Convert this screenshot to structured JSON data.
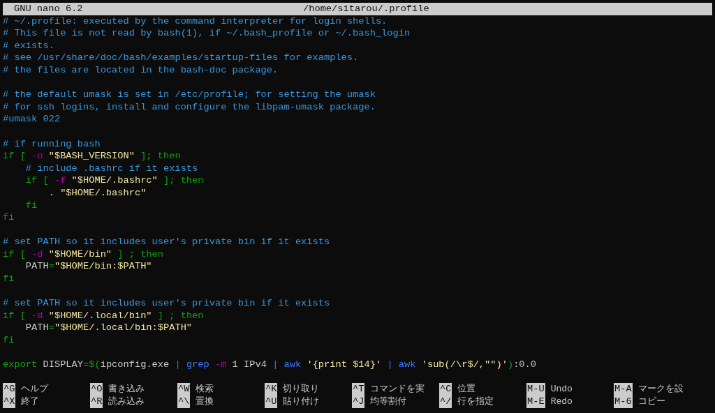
{
  "title_bar": {
    "app": "GNU nano 6.2",
    "file": "/home/sitarou/.profile"
  },
  "lines": [
    {
      "kind": "code",
      "segments": [
        {
          "kind": "comment",
          "text": "# ~/.profile: executed by the command interpreter for login shells."
        }
      ]
    },
    {
      "kind": "code",
      "segments": [
        {
          "kind": "comment",
          "text": "# This file is not read by bash(1), if ~/.bash_profile or ~/.bash_login"
        }
      ]
    },
    {
      "kind": "code",
      "segments": [
        {
          "kind": "comment",
          "text": "# exists."
        }
      ]
    },
    {
      "kind": "code",
      "segments": [
        {
          "kind": "comment",
          "text": "# see /usr/share/doc/bash/examples/startup-files for examples."
        }
      ]
    },
    {
      "kind": "code",
      "segments": [
        {
          "kind": "comment",
          "text": "# the files are located in the bash-doc package."
        }
      ]
    },
    {
      "kind": "blank"
    },
    {
      "kind": "code",
      "segments": [
        {
          "kind": "comment",
          "text": "# the default umask is set in /etc/profile; for setting the umask"
        }
      ]
    },
    {
      "kind": "code",
      "segments": [
        {
          "kind": "comment",
          "text": "# for ssh logins, install and configure the libpam-umask package."
        }
      ]
    },
    {
      "kind": "code",
      "segments": [
        {
          "kind": "comment",
          "text": "#umask 022"
        }
      ]
    },
    {
      "kind": "blank"
    },
    {
      "kind": "code",
      "segments": [
        {
          "kind": "comment",
          "text": "# if running bash"
        }
      ]
    },
    {
      "kind": "code",
      "segments": [
        {
          "kind": "keyword",
          "text": "if ["
        },
        {
          "kind": "flag",
          "text": " -n"
        },
        {
          "kind": "string",
          "text": " \"$BASH_VERSION\""
        },
        {
          "kind": "keyword",
          "text": " ]; then"
        }
      ]
    },
    {
      "kind": "code",
      "segments": [
        {
          "kind": "comment",
          "text": "    # include .bashrc if it exists"
        }
      ]
    },
    {
      "kind": "code",
      "segments": [
        {
          "kind": "keyword",
          "text": "    if ["
        },
        {
          "kind": "flag",
          "text": " -f"
        },
        {
          "kind": "string",
          "text": " \"$HOME/.bashrc\""
        },
        {
          "kind": "keyword",
          "text": " ]; then"
        }
      ]
    },
    {
      "kind": "code",
      "segments": [
        {
          "kind": "plain",
          "text": "        ."
        },
        {
          "kind": "string",
          "text": " \"$HOME/.bashrc\""
        }
      ]
    },
    {
      "kind": "code",
      "segments": [
        {
          "kind": "keyword",
          "text": "    fi"
        }
      ]
    },
    {
      "kind": "code",
      "segments": [
        {
          "kind": "keyword",
          "text": "fi"
        }
      ]
    },
    {
      "kind": "blank"
    },
    {
      "kind": "code",
      "segments": [
        {
          "kind": "comment",
          "text": "# set PATH so it includes user's private bin if it exists"
        }
      ]
    },
    {
      "kind": "code",
      "segments": [
        {
          "kind": "keyword",
          "text": "if ["
        },
        {
          "kind": "flag",
          "text": " -d"
        },
        {
          "kind": "string",
          "text": " \"$HOME/bin\""
        },
        {
          "kind": "keyword",
          "text": " ] ; then"
        }
      ]
    },
    {
      "kind": "code",
      "segments": [
        {
          "kind": "plain",
          "text": "    PATH"
        },
        {
          "kind": "keyword",
          "text": "="
        },
        {
          "kind": "string",
          "text": "\"$HOME/bin:$PATH\""
        }
      ]
    },
    {
      "kind": "code",
      "segments": [
        {
          "kind": "keyword",
          "text": "fi"
        }
      ]
    },
    {
      "kind": "blank"
    },
    {
      "kind": "code",
      "segments": [
        {
          "kind": "comment",
          "text": "# set PATH so it includes user's private bin if it exists"
        }
      ]
    },
    {
      "kind": "code",
      "segments": [
        {
          "kind": "keyword",
          "text": "if ["
        },
        {
          "kind": "flag",
          "text": " -d"
        },
        {
          "kind": "string",
          "text": " \"$HOME/.local/bin\""
        },
        {
          "kind": "keyword",
          "text": " ] ; then"
        }
      ]
    },
    {
      "kind": "code",
      "segments": [
        {
          "kind": "plain",
          "text": "    PATH"
        },
        {
          "kind": "keyword",
          "text": "="
        },
        {
          "kind": "string",
          "text": "\"$HOME/.local/bin:$PATH\""
        }
      ]
    },
    {
      "kind": "code",
      "segments": [
        {
          "kind": "keyword",
          "text": "fi"
        }
      ]
    },
    {
      "kind": "blank"
    },
    {
      "kind": "code",
      "segments": [
        {
          "kind": "keyword",
          "text": "export"
        },
        {
          "kind": "plain",
          "text": " DISPLAY"
        },
        {
          "kind": "keyword",
          "text": "=$("
        },
        {
          "kind": "plain",
          "text": "ipconfig.exe "
        },
        {
          "kind": "command",
          "text": "| grep"
        },
        {
          "kind": "flag",
          "text": " -m"
        },
        {
          "kind": "plain",
          "text": " 1 IPv4 "
        },
        {
          "kind": "command",
          "text": "| awk"
        },
        {
          "kind": "string",
          "text": " '{print $14}'"
        },
        {
          "kind": "command",
          "text": " | awk"
        },
        {
          "kind": "string",
          "text": " 'sub(/\\r$/,\"\")'"
        },
        {
          "kind": "keyword",
          "text": ")"
        },
        {
          "kind": "plain",
          "text": ":0.0"
        }
      ]
    }
  ],
  "shortcuts": [
    [
      {
        "key": "^G",
        "label": "ヘルプ"
      },
      {
        "key": "^O",
        "label": "書き込み"
      },
      {
        "key": "^W",
        "label": "検索"
      },
      {
        "key": "^K",
        "label": "切り取り"
      },
      {
        "key": "^T",
        "label": "コマンドを実"
      },
      {
        "key": "^C",
        "label": "位置"
      },
      {
        "key": "M-U",
        "label": "Undo"
      },
      {
        "key": "M-A",
        "label": "マークを設"
      }
    ],
    [
      {
        "key": "^X",
        "label": "終了"
      },
      {
        "key": "^R",
        "label": "読み込み"
      },
      {
        "key": "^\\",
        "label": "置換"
      },
      {
        "key": "^U",
        "label": "貼り付け"
      },
      {
        "key": "^J",
        "label": "均等割付"
      },
      {
        "key": "^/",
        "label": "行を指定"
      },
      {
        "key": "M-E",
        "label": "Redo"
      },
      {
        "key": "M-6",
        "label": "コピー"
      }
    ]
  ]
}
